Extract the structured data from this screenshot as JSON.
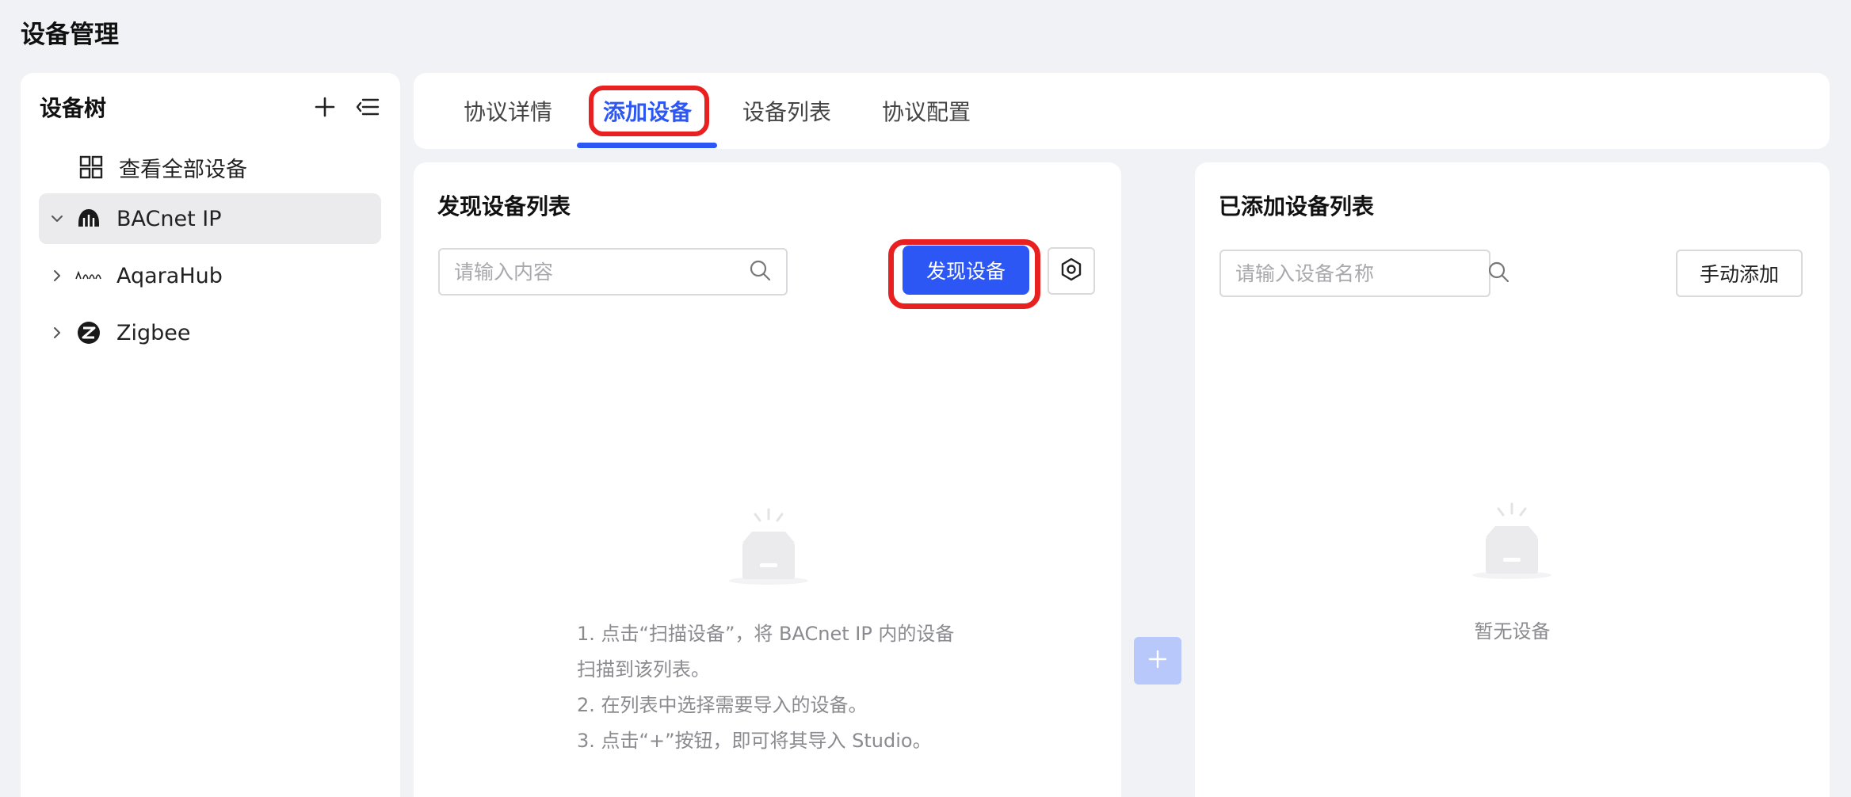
{
  "page": {
    "title": "设备管理"
  },
  "sidebar": {
    "title": "设备树",
    "all_devices_label": "查看全部设备",
    "items": [
      {
        "label": "BACnet IP",
        "icon": "bacnet-icon",
        "expanded": true,
        "active": true
      },
      {
        "label": "AqaraHub",
        "icon": "aqara-icon",
        "expanded": false,
        "active": false
      },
      {
        "label": "Zigbee",
        "icon": "zigbee-icon",
        "expanded": false,
        "active": false
      }
    ]
  },
  "tabs": [
    {
      "label": "协议详情",
      "active": false
    },
    {
      "label": "添加设备",
      "active": true
    },
    {
      "label": "设备列表",
      "active": false
    },
    {
      "label": "协议配置",
      "active": false
    }
  ],
  "discover_panel": {
    "title": "发现设备列表",
    "search_placeholder": "请输入内容",
    "discover_button": "发现设备",
    "instructions": [
      "1. 点击“扫描设备”，将 BACnet IP 内的设备",
      "扫描到该列表。",
      "2. 在列表中选择需要导入的设备。",
      "3. 点击“+”按钮，即可将其导入 Studio。"
    ]
  },
  "added_panel": {
    "title": "已添加设备列表",
    "search_placeholder": "请输入设备名称",
    "manual_add_button": "手动添加",
    "empty_text": "暂无设备"
  },
  "colors": {
    "accent": "#2d57f5",
    "highlight": "#e8201f",
    "background": "#f1f2f6"
  }
}
